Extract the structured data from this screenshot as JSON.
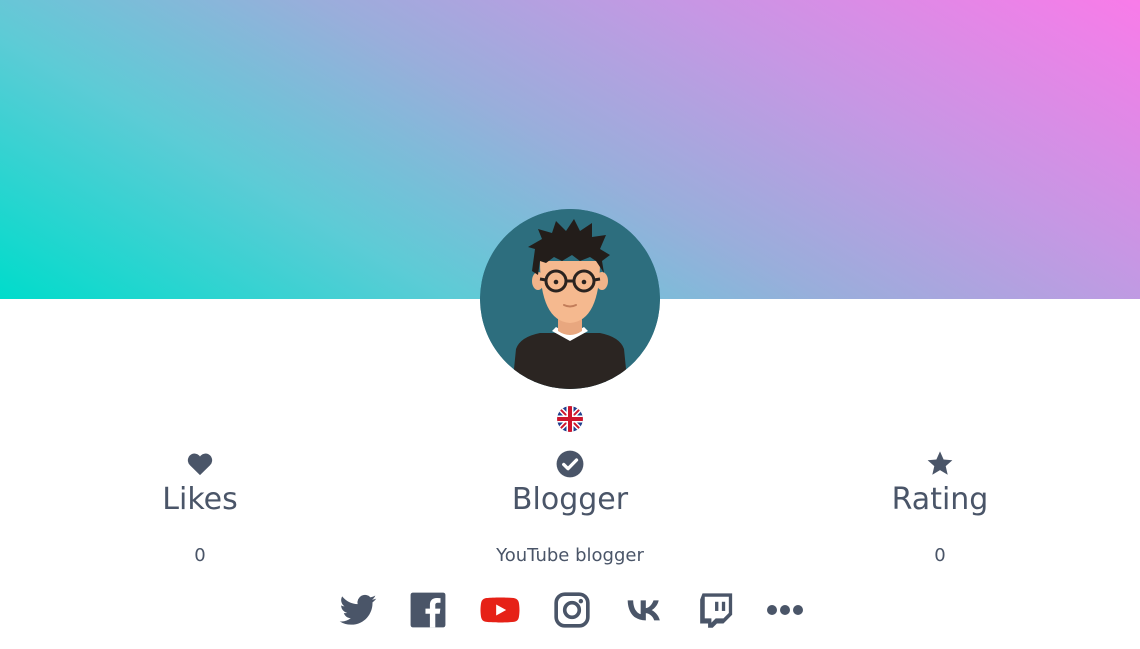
{
  "profile": {
    "avatar_icon": "avatar-illustration-icon",
    "flag_icon": "uk-flag-icon"
  },
  "stats": {
    "likes": {
      "icon": "heart-icon",
      "label": "Likes",
      "value": "0"
    },
    "blogger": {
      "icon": "check-circle-icon",
      "label": "Blogger",
      "value": "YouTube blogger"
    },
    "rating": {
      "icon": "star-icon",
      "label": "Rating",
      "value": "0"
    }
  },
  "socials": [
    {
      "icon": "twitter-icon"
    },
    {
      "icon": "facebook-icon"
    },
    {
      "icon": "youtube-icon"
    },
    {
      "icon": "instagram-icon"
    },
    {
      "icon": "vk-icon"
    },
    {
      "icon": "twitch-icon"
    },
    {
      "icon": "more-dots-icon"
    }
  ],
  "colors": {
    "text": "#4a5568",
    "icon": "#4a5568",
    "youtube": "#e62117",
    "cover_start": "#00dccb",
    "cover_end": "#f97be9",
    "avatar_bg": "#2d6e7e"
  }
}
